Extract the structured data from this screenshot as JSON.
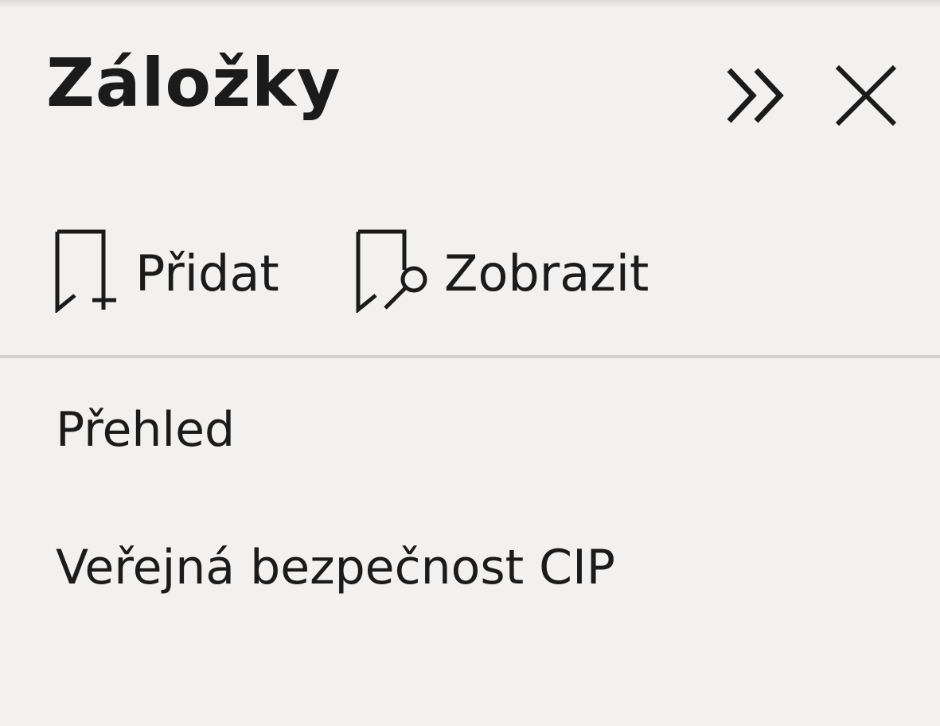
{
  "panel": {
    "title": "Záložky",
    "collapse_icon": "double-chevron-right-icon",
    "close_icon": "close-icon"
  },
  "toolbar": {
    "add_label": "Přidat",
    "add_icon": "bookmark-add-icon",
    "view_label": "Zobrazit",
    "view_icon": "bookmark-view-icon"
  },
  "bookmarks": [
    {
      "label": "Přehled"
    },
    {
      "label": "Veřejná bezpečnost CIP"
    }
  ],
  "colors": {
    "background": "#f2f1f0",
    "text": "#1b1b1b",
    "divider": "#d2d1d0"
  }
}
